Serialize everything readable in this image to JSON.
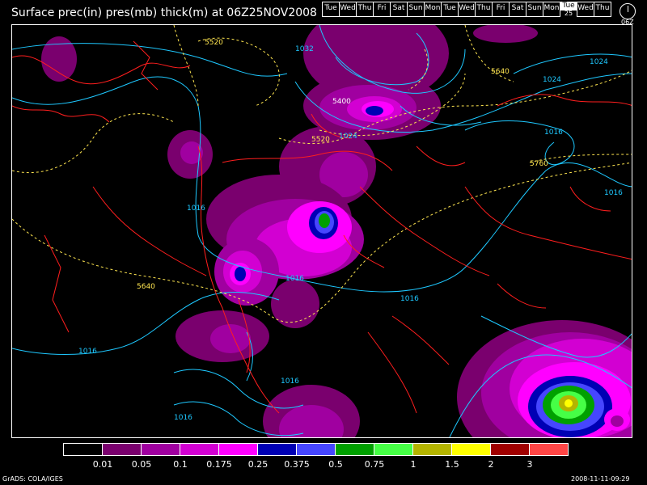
{
  "title": "Surface prec(in) pres(mb) thick(m) at 06Z25NOV2008",
  "days": [
    "Tue",
    "Wed",
    "Thu",
    "Fri",
    "Sat",
    "Sun",
    "Mon",
    "Tue",
    "Wed",
    "Thu",
    "Fri",
    "Sat",
    "Sun",
    "Mon",
    "Tue",
    "Wed",
    "Thu"
  ],
  "active_day_index": 14,
  "active_day_date": "25",
  "clock_label": "06Z",
  "legend": {
    "colors": [
      "#000000",
      "#7a006e",
      "#a000a0",
      "#d200d2",
      "#ff00ff",
      "#0000b4",
      "#4646ff",
      "#00a000",
      "#46ff46",
      "#b4b400",
      "#ffff00",
      "#a00000",
      "#ff4646"
    ],
    "labels": [
      "0.01",
      "0.05",
      "0.1",
      "0.175",
      "0.25",
      "0.375",
      "0.5",
      "0.75",
      "1",
      "1.5",
      "2",
      "3"
    ]
  },
  "contour_labels": {
    "pressure": [
      "1032",
      "1024",
      "1024",
      "1024",
      "1016",
      "1016",
      "1016",
      "1016",
      "1016",
      "1016",
      "1016",
      "1016"
    ],
    "thickness": [
      "5520",
      "5640",
      "5400",
      "5520",
      "5760",
      "5640"
    ]
  },
  "credit": "GrADS: COLA/IGES",
  "timestamp": "2008-11-11-09:29"
}
